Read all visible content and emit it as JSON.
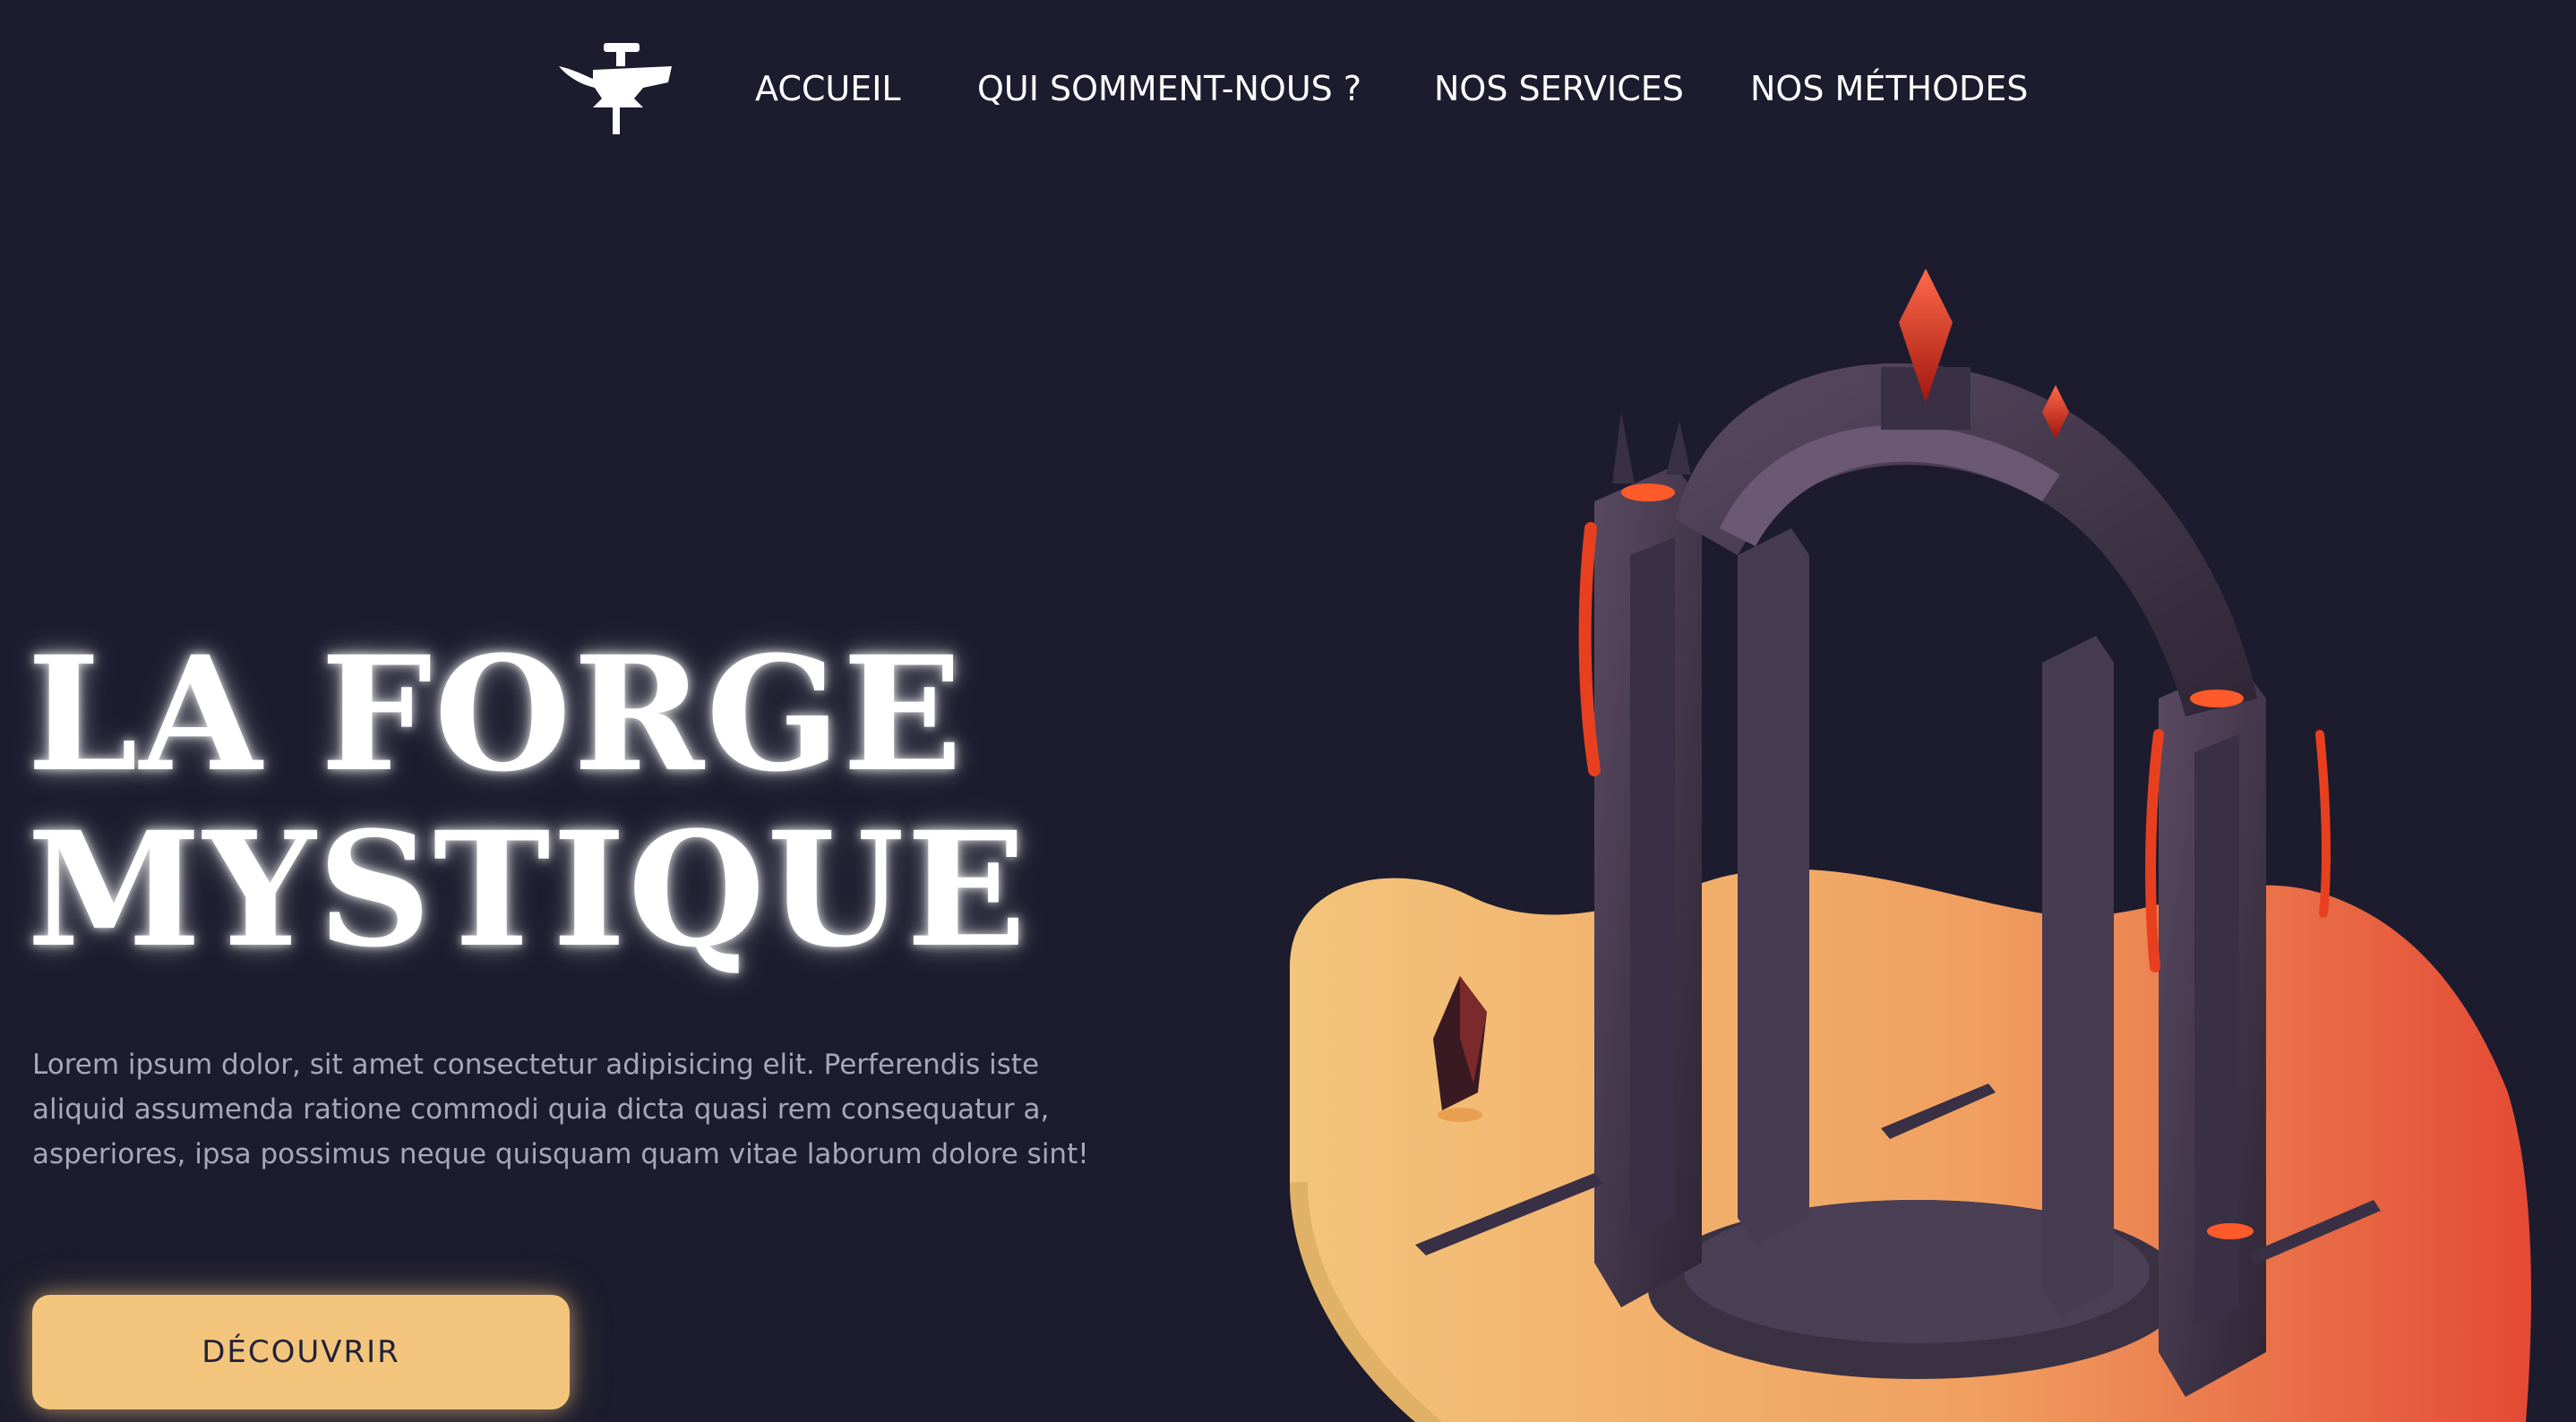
{
  "nav": {
    "logo_icon": "anvil-icon",
    "links": [
      {
        "label": "ACCUEIL"
      },
      {
        "label": "QUI SOMMENT-NOUS ?"
      },
      {
        "label": "NOS SERVICES"
      },
      {
        "label": "NOS MÉTHODES"
      }
    ]
  },
  "hero": {
    "title_line1": "LA FORGE",
    "title_line2": "MYSTIQUE",
    "description": "Lorem ipsum dolor, sit amet consectetur adipisicing elit. Perferendis iste aliquid assumenda ratione commodi quia dicta quasi rem consequatur a, asperiores, ipsa possimus neque quisquam quam vitae laborum dolore sint!",
    "button_label": "DÉCOUVRIR"
  },
  "illustration": {
    "subject": "dark-stone-portal-with-red-crystals-and-lava"
  },
  "colors": {
    "background": "#1c1c2e",
    "accent": "#f3c57c",
    "gradient_end": "#e44a35",
    "text_muted": "#a7a7b8"
  }
}
